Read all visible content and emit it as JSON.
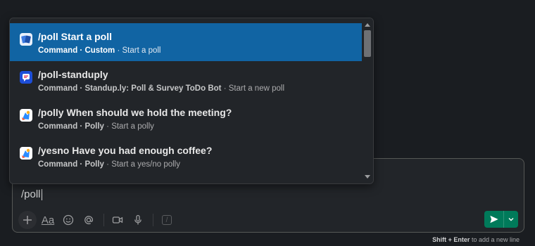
{
  "popup": {
    "items": [
      {
        "title": "/poll Start a poll",
        "command": "Command",
        "app": "Custom",
        "action": "Start a poll",
        "icon": "poll-app-icon",
        "selected": true
      },
      {
        "title": "/poll-standuply",
        "command": "Command",
        "app": "Standup.ly: Poll & Survey ToDo Bot",
        "action": "Start a new poll",
        "icon": "standuply-app-icon"
      },
      {
        "title": "/polly When should we hold the meeting?",
        "command": "Command",
        "app": "Polly",
        "action": "Start a polly",
        "icon": "polly-app-icon"
      },
      {
        "title": "/yesno Have you had enough coffee?",
        "command": "Command",
        "app": "Polly",
        "action": "Start a yes/no polly",
        "icon": "polly-app-icon"
      }
    ]
  },
  "composer": {
    "text": "/poll",
    "format_label": "Aa",
    "hint_keys": "Shift + Enter",
    "hint_rest": "to add a new line"
  },
  "colors": {
    "selected_bg": "#1164a3",
    "send_bg": "#007a5a",
    "app_bg": "#1a1d21"
  }
}
